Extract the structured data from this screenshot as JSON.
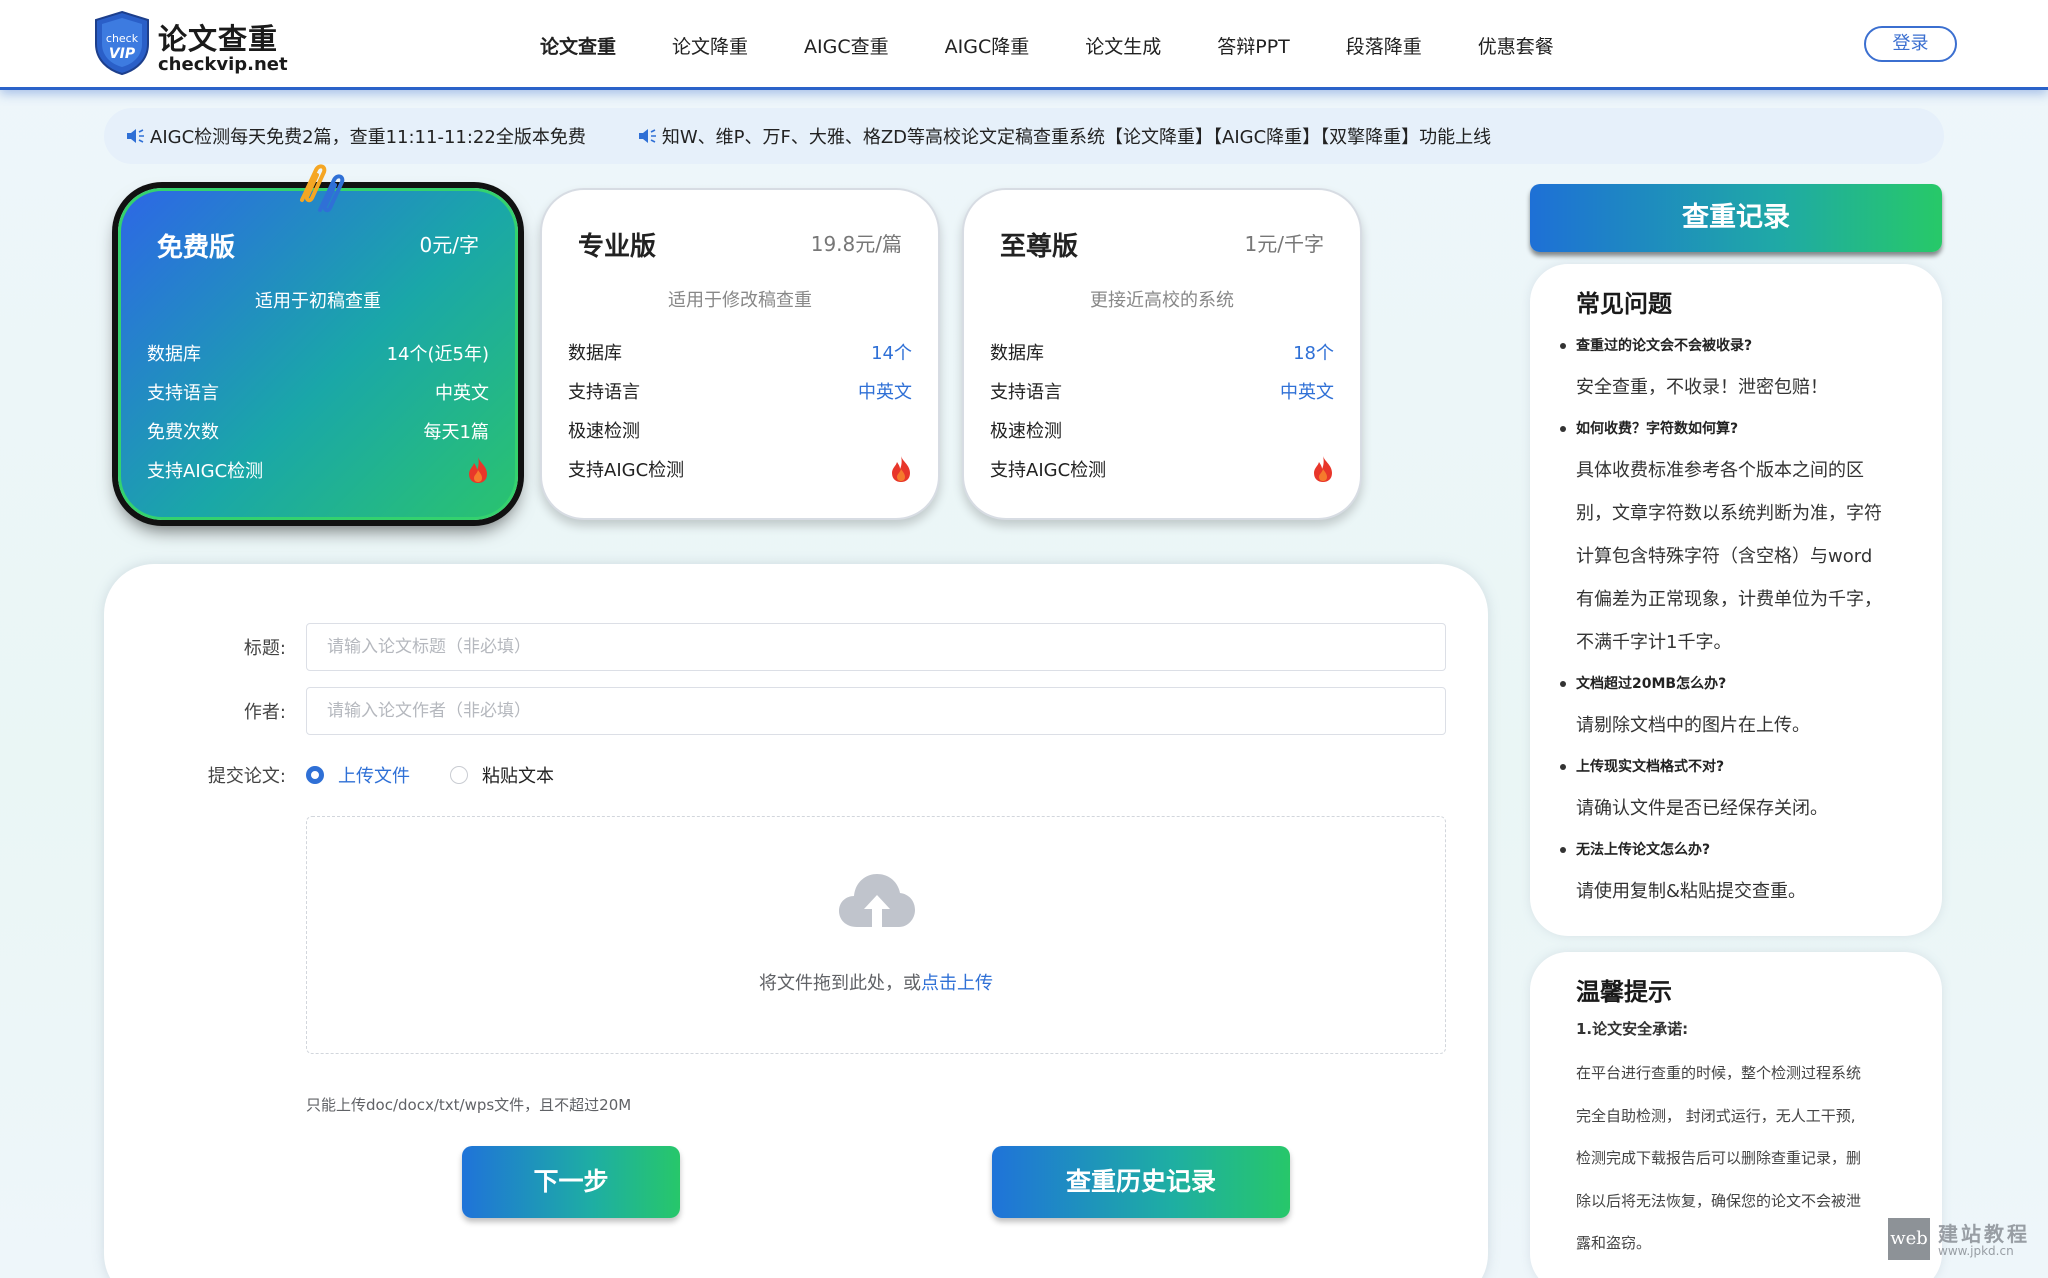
{
  "brand": {
    "title": "论文查重",
    "domain": "checkvip.net",
    "shield_text_top": "check",
    "shield_text_bottom": "VIP"
  },
  "nav": [
    {
      "label": "论文查重",
      "active": true
    },
    {
      "label": "论文降重"
    },
    {
      "label": "AIGC查重"
    },
    {
      "label": "AIGC降重"
    },
    {
      "label": "论文生成"
    },
    {
      "label": "答辩PPT"
    },
    {
      "label": "段落降重"
    },
    {
      "label": "优惠套餐"
    }
  ],
  "login_label": "登录",
  "notices": [
    "AIGC检测每天免费2篇，查重11:11-11:22全版本免费",
    "知W、维P、万F、大雅、格ZD等高校论文定稿查重系统【论文降重】【AIGC降重】【双擎降重】功能上线"
  ],
  "plans": [
    {
      "name": "免费版",
      "price": "0元/字",
      "desc": "适用于初稿查重",
      "rows": [
        {
          "label": "数据库",
          "value": "14个(近5年)"
        },
        {
          "label": "支持语言",
          "value": "中英文"
        },
        {
          "label": "免费次数",
          "value": "每天1篇"
        },
        {
          "label": "支持AIGC检测",
          "value": ""
        }
      ]
    },
    {
      "name": "专业版",
      "price": "19.8元/篇",
      "desc": "适用于修改稿查重",
      "rows": [
        {
          "label": "数据库",
          "value": "14个"
        },
        {
          "label": "支持语言",
          "value": "中英文"
        },
        {
          "label": "极速检测",
          "value": ""
        },
        {
          "label": "支持AIGC检测",
          "value": ""
        }
      ]
    },
    {
      "name": "至尊版",
      "price": "1元/千字",
      "desc": "更接近高校的系统",
      "rows": [
        {
          "label": "数据库",
          "value": "18个"
        },
        {
          "label": "支持语言",
          "value": "中英文"
        },
        {
          "label": "极速检测",
          "value": ""
        },
        {
          "label": "支持AIGC检测",
          "value": ""
        }
      ]
    }
  ],
  "form": {
    "title_label": "标题:",
    "title_placeholder": "请输入论文标题（非必填）",
    "author_label": "作者:",
    "author_placeholder": "请输入论文作者（非必填）",
    "submit_label": "提交论文:",
    "radio_upload": "上传文件",
    "radio_paste": "粘贴文本",
    "drop_text": "将文件拖到此处，或",
    "drop_link": "点击上传",
    "tip": "只能上传doc/docx/txt/wps文件，且不超过20M",
    "next_label": "下一步",
    "history_label": "查重历史记录"
  },
  "sidebar": {
    "record_label": "查重记录",
    "faq_title": "常见问题",
    "faq": [
      {
        "q": "查重过的论文会不会被收录?",
        "a": [
          "安全查重，不收录！泄密包赔！"
        ]
      },
      {
        "q": "如何收费？字符数如何算?",
        "a": [
          "具体收费标准参考各个版本之间的区",
          "别，文章字符数以系统判断为准，字符",
          "计算包含特殊字符（含空格）与word",
          "有偏差为正常现象，计费单位为千字，",
          "不满千字计1千字。"
        ]
      },
      {
        "q": "文档超过20MB怎么办?",
        "a": [
          "请剔除文档中的图片在上传。"
        ]
      },
      {
        "q": "上传现实文档格式不对?",
        "a": [
          "请确认文件是否已经保存关闭。"
        ]
      },
      {
        "q": "无法上传论文怎么办?",
        "a": [
          "请使用复制&粘贴提交查重。"
        ]
      }
    ],
    "tips_title": "温馨提示",
    "tips_sub": "1.论文安全承诺:",
    "tips_lines": [
      "在平台进行查重的时候，整个检测过程系统",
      "完全自助检测， 封闭式运行，无人工干预,",
      "检测完成下载报告后可以删除查重记录，删",
      "除以后将无法恢复，确保您的论文不会被泄",
      "露和盗窃。"
    ]
  },
  "watermark": {
    "box": "web",
    "title": "建站教程",
    "url": "www.jpkd.cn"
  },
  "colors": {
    "accent": "#2f70d6",
    "gradient_start": "#1f73d9",
    "gradient_end": "#27c76a",
    "flame": "#e8362a"
  }
}
